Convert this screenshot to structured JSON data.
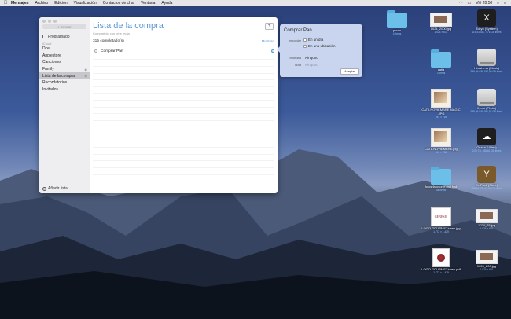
{
  "menubar": {
    "app": "Mensajes",
    "items": [
      "Archivo",
      "Edición",
      "Visualización",
      "Contactos de chat",
      "Ventana",
      "Ayuda"
    ],
    "clock": "Vié 20:50"
  },
  "sidebar": {
    "search_placeholder": "Buscar",
    "scheduled_label": "Programado",
    "group_label": "iCloud",
    "items": [
      {
        "label": "Dce"
      },
      {
        "label": "Applestore"
      },
      {
        "label": "Canciones"
      },
      {
        "label": "Family"
      },
      {
        "label": "Lista de la compra",
        "selected": true
      },
      {
        "label": "Recordatorios"
      },
      {
        "label": "Invitados"
      }
    ],
    "add_list_label": "Añadir lista"
  },
  "list": {
    "title": "Lista de la compra",
    "subtitle": "Compartido con leire moja",
    "completed_text": "315 completado(s)",
    "show_label": "Mostrar",
    "tasks": [
      {
        "label": "Comprar Pan"
      }
    ]
  },
  "detail": {
    "title": "Comprar Pan",
    "remind_label": "recordar",
    "opt_day": "En un día",
    "opt_location": "En una ubicación",
    "priority_label": "prioridad",
    "priority_value": "Ninguno",
    "note_label": "nota",
    "note_placeholder": "Ninguno",
    "accept_label": "Aceptar"
  },
  "desktop_icons": [
    {
      "name": "photo",
      "info": "4 ítems",
      "kind": "folder"
    },
    {
      "name": "1024_2000.jpg",
      "info": "1.024 × 631",
      "kind": "shot"
    },
    {
      "name": "Tokyo (System)",
      "info": "119,51 GB, 7,76 GB libres",
      "kind": "dark",
      "glyph": "X"
    },
    {
      "name": "catia",
      "info": "3 ítems",
      "kind": "folder"
    },
    {
      "name": "Hiroshima (Music)",
      "info": "999,86 GB, 187,59 GB libres",
      "kind": "disk"
    },
    {
      "name": "CATA NOVIEMBRE MAGIC .JPG",
      "info": "944 × 765",
      "kind": "photo"
    },
    {
      "name": "Kyoto (Photo)",
      "info": "999,86 GB, 381,57 GB libres",
      "kind": "disk"
    },
    {
      "name": "CATA NOVIEMBRE.jpg",
      "info": "944 × 765",
      "kind": "photo"
    },
    {
      "name": "Osaka (Video)",
      "info": "2,00 TB, 188,42 GB libres",
      "kind": "dark",
      "glyph": "☁"
    },
    {
      "name": "fotos farosorre mol ball",
      "info": "44 ítems",
      "kind": "folder"
    },
    {
      "name": "RetPack (Store)",
      "info": "999,86 GB, 91,94 GB libres",
      "kind": "dark",
      "glyph": "Y"
    },
    {
      "name": "LOGO GOURMET+web.jpg",
      "info": "1.772 × 1.429",
      "kind": "logo",
      "glyph": "GENESIS"
    },
    {
      "name": "1024_25.jpg",
      "info": "1.024 × 631",
      "kind": "shot"
    },
    {
      "name": "LOGO GOURMET+web.pdf",
      "info": "1.772 × 1.429",
      "kind": "pdf"
    },
    {
      "name": "1024_200.jpg",
      "info": "1.024 × 631",
      "kind": "shot"
    }
  ]
}
